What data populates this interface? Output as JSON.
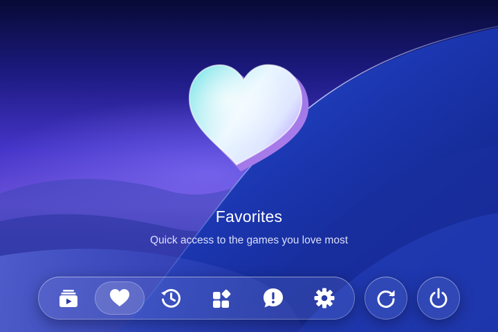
{
  "hero": {
    "title": "Favorites",
    "subtitle": "Quick access to the games you love most"
  },
  "dock": {
    "selected": "favorites",
    "items": [
      {
        "id": "media",
        "icon": "play-stack-icon"
      },
      {
        "id": "favorites",
        "icon": "heart-icon"
      },
      {
        "id": "history",
        "icon": "history-icon"
      },
      {
        "id": "apps",
        "icon": "grid-shapes-icon"
      },
      {
        "id": "alerts",
        "icon": "alert-bubble-icon"
      },
      {
        "id": "settings",
        "icon": "gear-icon"
      }
    ]
  },
  "actions": [
    {
      "id": "refresh",
      "icon": "refresh-icon"
    },
    {
      "id": "power",
      "icon": "power-icon"
    }
  ],
  "colors": {
    "background_top": "#0a0c3e",
    "background_mid": "#4a3fd0",
    "wave": "#1f3fc2",
    "icon": "#ffffff"
  }
}
